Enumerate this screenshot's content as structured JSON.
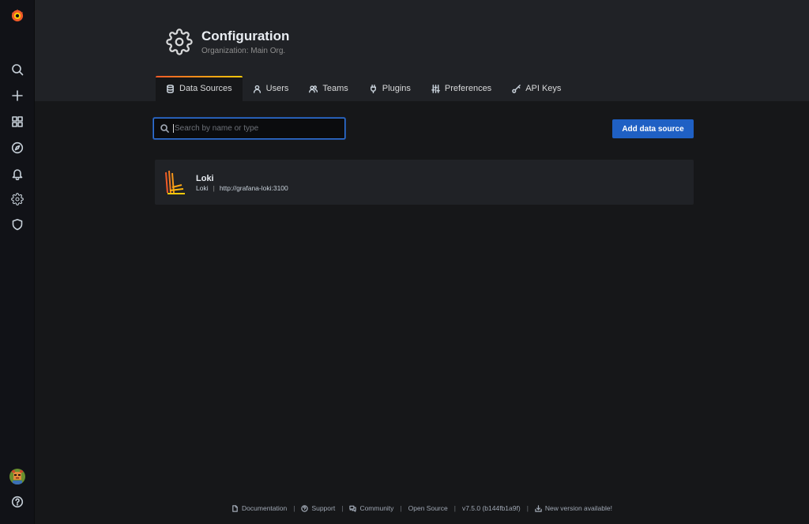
{
  "sidebar": {
    "logo_icon": "grafana-logo-icon",
    "items": [
      {
        "name": "search",
        "icon": "search-icon"
      },
      {
        "name": "create",
        "icon": "plus-icon"
      },
      {
        "name": "dashboards",
        "icon": "apps-icon"
      },
      {
        "name": "explore",
        "icon": "compass-icon"
      },
      {
        "name": "alerting",
        "icon": "bell-icon"
      },
      {
        "name": "configuration",
        "icon": "gear-icon"
      },
      {
        "name": "server-admin",
        "icon": "shield-icon"
      }
    ],
    "bottom": [
      {
        "name": "profile",
        "icon": "avatar"
      },
      {
        "name": "help",
        "icon": "question-circle-icon"
      }
    ]
  },
  "header": {
    "icon": "gear-icon",
    "title": "Configuration",
    "subtitle": "Organization: Main Org."
  },
  "tabs": [
    {
      "label": "Data Sources",
      "icon": "database-icon",
      "active": true
    },
    {
      "label": "Users",
      "icon": "user-icon",
      "active": false
    },
    {
      "label": "Teams",
      "icon": "users-icon",
      "active": false
    },
    {
      "label": "Plugins",
      "icon": "plug-icon",
      "active": false
    },
    {
      "label": "Preferences",
      "icon": "sliders-icon",
      "active": false
    },
    {
      "label": "API Keys",
      "icon": "key-icon",
      "active": false
    }
  ],
  "toolbar": {
    "search_placeholder": "Search by name or type",
    "search_value": "",
    "add_label": "Add data source"
  },
  "datasources": [
    {
      "name": "Loki",
      "type": "Loki",
      "separator": "|",
      "url": "http://grafana-loki:3100",
      "icon": "loki-logo-icon"
    }
  ],
  "footer": {
    "items": [
      {
        "label": "Documentation",
        "icon": "document-icon"
      },
      {
        "label": "Support",
        "icon": "question-circle-icon"
      },
      {
        "label": "Community",
        "icon": "comments-icon"
      },
      {
        "label": "Open Source",
        "icon": ""
      },
      {
        "label": "v7.5.0 (b144fb1a9f)",
        "icon": ""
      },
      {
        "label": "New version available!",
        "icon": "download-icon"
      }
    ],
    "separator": "|"
  },
  "colors": {
    "accent_blue": "#1f60c4",
    "tab_gradient_start": "#f05a28",
    "tab_gradient_end": "#fbca0a",
    "background": "#161719",
    "panel": "#202226"
  }
}
